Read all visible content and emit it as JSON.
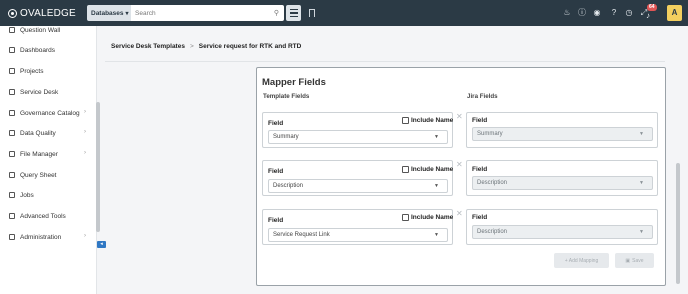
{
  "header": {
    "logo_text": "OVALEDGE",
    "db_select": "Databases",
    "search_placeholder": "Search",
    "notification_count": "64",
    "avatar_initial": "A"
  },
  "sidebar": {
    "items": [
      {
        "label": "Question Wall",
        "has_arrow": false
      },
      {
        "label": "Dashboards",
        "has_arrow": false
      },
      {
        "label": "Projects",
        "has_arrow": false
      },
      {
        "label": "Service Desk",
        "has_arrow": false
      },
      {
        "label": "Governance Catalog",
        "has_arrow": true
      },
      {
        "label": "Data Quality",
        "has_arrow": true
      },
      {
        "label": "File Manager",
        "has_arrow": true
      },
      {
        "label": "Query Sheet",
        "has_arrow": false
      },
      {
        "label": "Jobs",
        "has_arrow": false
      },
      {
        "label": "Advanced Tools",
        "has_arrow": false
      },
      {
        "label": "Administration",
        "has_arrow": true
      }
    ]
  },
  "breadcrumb": {
    "parent": "Service Desk Templates",
    "separator": ">",
    "current": "Service request for RTK and RTD"
  },
  "mapper": {
    "title": "Mapper Fields",
    "template_heading": "Template Fields",
    "jira_heading": "Jira Fields",
    "rows": [
      {
        "field_label": "Field",
        "include_label": "Include Name",
        "template_value": "Summary",
        "jira_label": "Field",
        "jira_value": "Summary"
      },
      {
        "field_label": "Field",
        "include_label": "Include Name",
        "template_value": "Description",
        "jira_label": "Field",
        "jira_value": "Description"
      },
      {
        "field_label": "Field",
        "include_label": "Include Name",
        "template_value": "Service Request Link",
        "jira_label": "Field",
        "jira_value": "Description"
      }
    ],
    "add_mapping_label": "+ Add Mapping",
    "save_label": "Save"
  }
}
